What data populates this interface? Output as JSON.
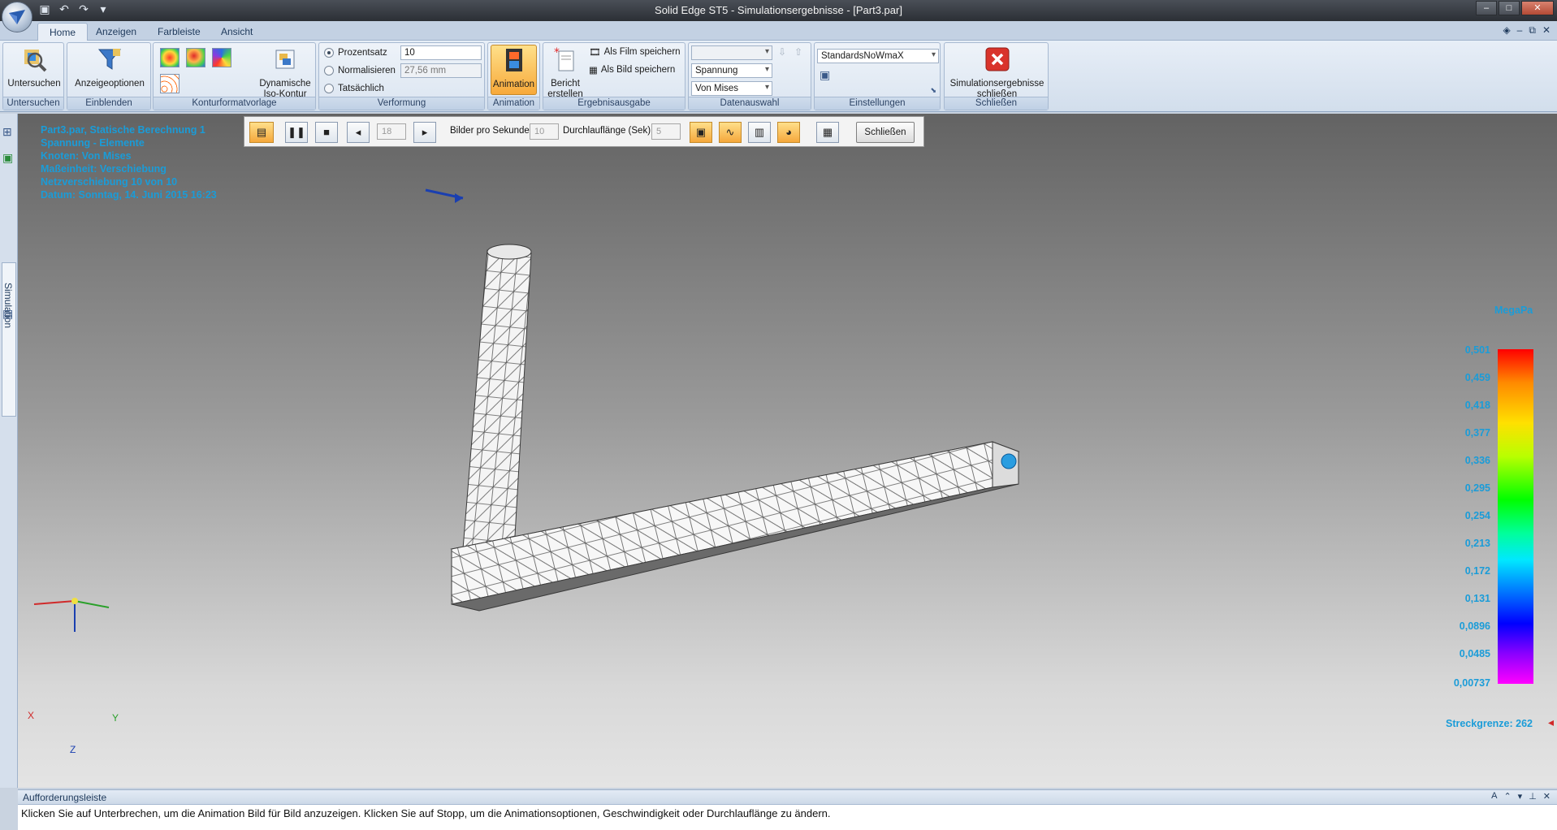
{
  "window": {
    "title": "Solid Edge ST5 - Simulationsergebnisse - [Part3.par]"
  },
  "tabs": [
    {
      "label": "Home"
    },
    {
      "label": "Anzeigen"
    },
    {
      "label": "Farbleiste"
    },
    {
      "label": "Ansicht"
    }
  ],
  "ribbon": {
    "untersuchen": {
      "button": "Untersuchen",
      "group": "Untersuchen"
    },
    "einblenden": {
      "button": "Anzeigeoptionen",
      "group": "Einblenden"
    },
    "kontur": {
      "button_line1": "Dynamische",
      "button_line2": "Iso-Kontur",
      "group": "Konturformatvorlage"
    },
    "verformung": {
      "options": [
        "Prozentsatz",
        "Normalisieren",
        "Tatsächlich"
      ],
      "selected": "Prozentsatz",
      "prozent_value": "10",
      "normalisieren_value": "27,56 mm",
      "group": "Verformung"
    },
    "animation": {
      "button": "Animation",
      "group": "Animation"
    },
    "ergebnis": {
      "bericht_line1": "Bericht",
      "bericht_line2": "erstellen",
      "film": "Als Film speichern",
      "bild": "Als Bild speichern",
      "group": "Ergebnisausgabe"
    },
    "daten": {
      "combo1": "",
      "combo2": "Spannung",
      "combo3": "Von Mises",
      "group": "Datenauswahl"
    },
    "einstellungen": {
      "combo": "StandardsNoWmaX",
      "group": "Einstellungen"
    },
    "schliessen": {
      "line1": "Simulationsergebnisse",
      "line2": "schließen",
      "group": "Schließen"
    }
  },
  "leftrail": {
    "tab_label": "Simulation"
  },
  "viewport": {
    "info_lines": [
      "Part3.par, Statische Berechnung 1",
      "Spannung - Elemente",
      "Knoten: Von Mises",
      "Maßeinheit: Verschiebung",
      "Netzverschiebung 10 von 10",
      "Datum: Sonntag, 14. Juni 2015 16:23"
    ],
    "animation_toolbar": {
      "frame": "18",
      "fps_label": "Bilder pro Sekunde:",
      "fps_value": "10",
      "duration_label": "Durchlauflänge (Sek):",
      "duration_value": "5",
      "close_label": "Schließen"
    },
    "legend": {
      "unit": "MegaPa",
      "values": [
        "0,501",
        "0,459",
        "0,418",
        "0,377",
        "0,336",
        "0,295",
        "0,254",
        "0,213",
        "0,172",
        "0,131",
        "0,0896",
        "0,0485",
        "0,00737"
      ],
      "yield_label": "Streckgrenze: 262"
    },
    "triad": {
      "x": "X",
      "y": "Y",
      "z": "Z"
    }
  },
  "promptbar": {
    "title": "Aufforderungsleiste",
    "text": "Klicken Sie auf Unterbrechen, um die Animation Bild für Bild anzuzeigen. Klicken Sie auf Stopp, um die Animationsoptionen, Geschwindigkeit oder Durchlauflänge zu ändern."
  }
}
